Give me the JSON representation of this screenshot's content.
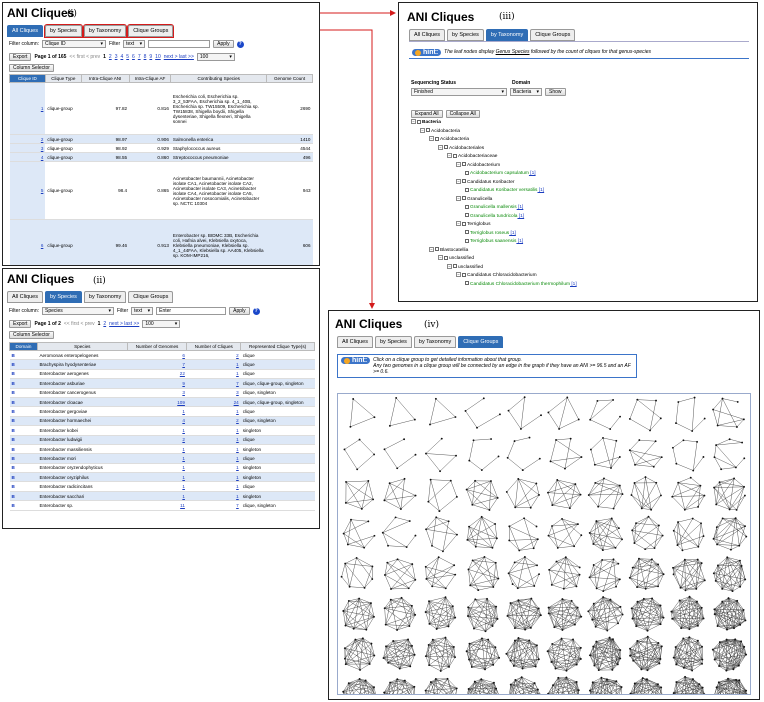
{
  "colors": {
    "accent": "#2f6db5",
    "highlight": "#d41b1b",
    "link": "#1a3cc0",
    "leaf": "#0a8a0a"
  },
  "panel_i": {
    "title": "ANI Cliques",
    "label": "(i)",
    "tabs": [
      "All Cliques",
      "by Species",
      "by Taxonomy",
      "Clique Groups"
    ],
    "filter_label": "Filter column:",
    "filter_column": "Clique ID",
    "filter_type_label": "Filter",
    "filter_type": "text",
    "apply": "Apply",
    "export": "Export",
    "column_selector": "Column Selector",
    "pagination": {
      "page_text": "Page 1 of 165",
      "first_prev": "<< first < prev",
      "current": "1",
      "pages": [
        "2",
        "3",
        "4",
        "5",
        "6",
        "7",
        "8",
        "9",
        "10"
      ],
      "next_last": "next > last >>",
      "page_size": "100"
    },
    "headers": [
      "Clique ID",
      "Clique Type",
      "Intra-Clique ANI",
      "Intra-Clique AF",
      "Contributing Species",
      "Genome Count"
    ],
    "rows": [
      {
        "id": "1",
        "type": "clique-group",
        "ani": "97.82",
        "af": "0.816",
        "species": "Escherichia coli, Escherichia sp. 3_2_53FAA, Escherichia sp. 4_1_40B, Escherichia sp. TW15509, Escherichia sp. TW15838, Shigella boydii, Shigella dysenteriae, Shigella flexneri, Shigella sonnei",
        "count": "2690"
      },
      {
        "id": "2",
        "type": "clique-group",
        "ani": "98.97",
        "af": "0.906",
        "species": "Salmonella enterica",
        "count": "1410"
      },
      {
        "id": "3",
        "type": "clique-group",
        "ani": "98.92",
        "af": "0.929",
        "species": "Staphylococcus aureus",
        "count": "4544"
      },
      {
        "id": "4",
        "type": "clique-group",
        "ani": "98.55",
        "af": "0.860",
        "species": "Streptococcus pneumoniae",
        "count": "496"
      },
      {
        "id": "5",
        "type": "clique-group",
        "ani": "98.4",
        "af": "0.865",
        "species": "Acinetobacter baumannii, Acinetobacter isolate CA1, Acinetobacter isolate CA2, Acinetobacter isolate CA3, Acinetobacter isolate CA4, Acinetobacter isolate CA5, Acinetobacter nosocomialis, Acinetobacter sp. NCTC 10304",
        "count": "943"
      },
      {
        "id": "6",
        "type": "clique-group",
        "ani": "99.46",
        "af": "0.913",
        "species": "Enterobacter sp. BIDMC 33B, Escherichia coli, Hafnia alvei, Klebsiella oxytoca, Klebsiella pneumoniae, Klebsiella sp. 4_1_44FAA, Klebsiella sp. AA405, Klebsiella sp. KOM-IMP216,",
        "count": "606"
      }
    ]
  },
  "panel_ii": {
    "title": "ANI Cliques",
    "label": "(ii)",
    "tabs": [
      "All Cliques",
      "by Species",
      "by Taxonomy",
      "Clique Groups"
    ],
    "filter_label": "Filter column:",
    "filter_column": "Species",
    "filter_type_label": "Filter",
    "filter_type": "text",
    "filter_value": "Enter",
    "apply": "Apply",
    "export": "Export",
    "column_selector": "Column Selector",
    "pagination": {
      "page_text": "Page 1 of 2",
      "first_prev": "<< first < prev",
      "current": "1",
      "pages": [
        "2"
      ],
      "next_last": "next > last >>",
      "page_size": "100"
    },
    "headers": [
      "Domain",
      "Species",
      "Number of Genomes",
      "Number of Cliques",
      "Represented Clique Type(s)"
    ],
    "rows": [
      {
        "d": "B",
        "sp": "Aeromonas enteropelogenes",
        "g": "6",
        "c": "2",
        "t": "clique"
      },
      {
        "d": "B",
        "sp": "Brachyspira hyodysenteriae",
        "g": "7",
        "c": "1",
        "t": "clique"
      },
      {
        "d": "B",
        "sp": "Enterobacter aerogenes",
        "g": "22",
        "c": "1",
        "t": "clique"
      },
      {
        "d": "B",
        "sp": "Enterobacter asburiae",
        "g": "9",
        "c": "7",
        "t": "clique, clique-group, singleton"
      },
      {
        "d": "B",
        "sp": "Enterobacter cancerogenus",
        "g": "3",
        "c": "3",
        "t": "clique, singleton"
      },
      {
        "d": "B",
        "sp": "Enterobacter cloacae",
        "g": "109",
        "c": "24",
        "t": "clique, clique-group, singleton"
      },
      {
        "d": "B",
        "sp": "Enterobacter gergoviae",
        "g": "1",
        "c": "1",
        "t": "clique"
      },
      {
        "d": "B",
        "sp": "Enterobacter hormaechei",
        "g": "4",
        "c": "2",
        "t": "clique, singleton"
      },
      {
        "d": "B",
        "sp": "Enterobacter kobei",
        "g": "1",
        "c": "1",
        "t": "singleton"
      },
      {
        "d": "B",
        "sp": "Enterobacter ludwigii",
        "g": "2",
        "c": "1",
        "t": "clique"
      },
      {
        "d": "B",
        "sp": "Enterobacter massiliensis",
        "g": "1",
        "c": "1",
        "t": "singleton"
      },
      {
        "d": "B",
        "sp": "Enterobacter mori",
        "g": "1",
        "c": "1",
        "t": "clique"
      },
      {
        "d": "B",
        "sp": "Enterobacter oryzendophyticus",
        "g": "1",
        "c": "1",
        "t": "singleton"
      },
      {
        "d": "B",
        "sp": "Enterobacter oryziphilus",
        "g": "1",
        "c": "1",
        "t": "singleton"
      },
      {
        "d": "B",
        "sp": "Enterobacter radicincitans",
        "g": "1",
        "c": "1",
        "t": "clique"
      },
      {
        "d": "B",
        "sp": "Enterobacter sacchari",
        "g": "1",
        "c": "1",
        "t": "singleton"
      },
      {
        "d": "B",
        "sp": "Enterobacter sp.",
        "g": "11",
        "c": "7",
        "t": "clique, singleton"
      }
    ]
  },
  "panel_iii": {
    "title": "ANI Cliques",
    "label": "(iii)",
    "tabs": [
      "All Cliques",
      "by Species",
      "by Taxonomy",
      "Clique Groups"
    ],
    "hint_badge": "hint:",
    "hint_pre": "The leaf nodes display ",
    "hint_genus": "Genus Species",
    "hint_post": " followed by the count of cliques for that genus-species",
    "seq_status_label": "Sequencing Status",
    "seq_status": "Finished",
    "domain_label": "Domain",
    "domain": "Bacteria",
    "show": "Show",
    "expand_all": "Expand All",
    "collapse_all": "Collapse All",
    "tree": [
      {
        "indent": 0,
        "text": "Bacteria",
        "bold": true
      },
      {
        "indent": 1,
        "text": "Acidobacteria"
      },
      {
        "indent": 2,
        "text": "Acidobacteria"
      },
      {
        "indent": 3,
        "text": "Acidobacteriales"
      },
      {
        "indent": 4,
        "text": "Acidobacteriaceae"
      },
      {
        "indent": 5,
        "text": "Acidobacterium"
      },
      {
        "indent": 6,
        "text": "Acidobacterium capsulatum",
        "leaf": true,
        "count": "[1]"
      },
      {
        "indent": 5,
        "text": "Candidatus Koribacter"
      },
      {
        "indent": 6,
        "text": "Candidatus Koribacter versatilis",
        "leaf": true,
        "count": "[1]"
      },
      {
        "indent": 5,
        "text": "Granulicella"
      },
      {
        "indent": 6,
        "text": "Granulicella mallensis",
        "leaf": true,
        "count": "[1]"
      },
      {
        "indent": 6,
        "text": "Granulicella tundricola",
        "leaf": true,
        "count": "[1]"
      },
      {
        "indent": 5,
        "text": "Terriglobus"
      },
      {
        "indent": 6,
        "text": "Terriglobus roseus",
        "leaf": true,
        "count": "[1]"
      },
      {
        "indent": 6,
        "text": "Terriglobus saanensis",
        "leaf": true,
        "count": "[1]"
      },
      {
        "indent": 2,
        "text": "Blastocatellia"
      },
      {
        "indent": 3,
        "text": "unclassified"
      },
      {
        "indent": 4,
        "text": "unclassified"
      },
      {
        "indent": 5,
        "text": "Candidatus Chloracidobacterium"
      },
      {
        "indent": 6,
        "text": "Candidatus Chloracidobacterium thermophilum",
        "leaf": true,
        "count": "[1]"
      }
    ]
  },
  "panel_iv": {
    "title": "ANI Cliques",
    "label": "(iv)",
    "tabs": [
      "All Cliques",
      "by Species",
      "by Taxonomy",
      "Clique Groups"
    ],
    "hint_badge": "hint:",
    "hint_line1": "Click on a clique group to get detailed information about that group.",
    "hint_line2": "Any two genomes in a clique group will be connected by an edge in the graph if they have an ANI >= 96.5 and an AF >= 0.6."
  }
}
